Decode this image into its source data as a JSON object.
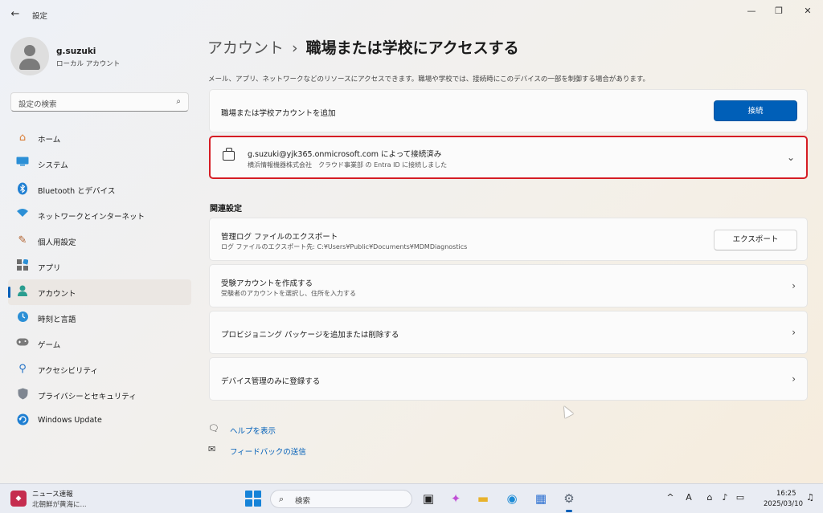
{
  "window": {
    "title": "設定",
    "back_icon": "back-arrow-icon",
    "controls": [
      "minimize",
      "restore",
      "close"
    ]
  },
  "user": {
    "name": "g.suzuki",
    "type": "ローカル アカウント"
  },
  "sidebar": {
    "search_placeholder": "設定の検索",
    "items": [
      {
        "label": "ホーム",
        "icon": "home-icon",
        "active": false
      },
      {
        "label": "システム",
        "icon": "system-icon",
        "active": false
      },
      {
        "label": "Bluetooth とデバイス",
        "icon": "bluetooth-icon",
        "active": false
      },
      {
        "label": "ネットワークとインターネット",
        "icon": "network-icon",
        "active": false
      },
      {
        "label": "個人用設定",
        "icon": "personalization-icon",
        "active": false
      },
      {
        "label": "アプリ",
        "icon": "apps-icon",
        "active": false
      },
      {
        "label": "アカウント",
        "icon": "accounts-icon",
        "active": true
      },
      {
        "label": "時刻と言語",
        "icon": "time-language-icon",
        "active": false
      },
      {
        "label": "ゲーム",
        "icon": "gaming-icon",
        "active": false
      },
      {
        "label": "アクセシビリティ",
        "icon": "accessibility-icon",
        "active": false
      },
      {
        "label": "プライバシーとセキュリティ",
        "icon": "privacy-shield-icon",
        "active": false
      },
      {
        "label": "Windows Update",
        "icon": "windows-update-icon",
        "active": false
      }
    ]
  },
  "main": {
    "breadcrumb_parent": "アカウント",
    "breadcrumb_separator": "›",
    "breadcrumb_current": "職場または学校にアクセスする",
    "description": "メール、アプリ、ネットワークなどのリソースにアクセスできます。職場や学校では、接続時にこのデバイスの一部を制御する場合があります。",
    "add_account": {
      "label": "職場または学校アカウントを追加",
      "button": "接続"
    },
    "connected_account": {
      "title": "g.suzuki@yjk365.onmicrosoft.com によって接続済み",
      "subtitle": "横浜情報機器株式会社　クラウド事業部 の Entra ID に接続しました",
      "icon": "briefcase-icon"
    },
    "related_heading": "関連設定",
    "related": [
      {
        "title": "管理ログ ファイルのエクスポート",
        "subtitle": "ログ ファイルのエクスポート先: C:¥Users¥Public¥Documents¥MDMDiagnostics",
        "button": "エクスポート"
      },
      {
        "title": "受験アカウントを作成する",
        "subtitle": "受験者のアカウントを選択し、住所を入力する"
      },
      {
        "title": "プロビジョニング パッケージを追加または削除する",
        "subtitle": ""
      },
      {
        "title": "デバイス管理のみに登録する",
        "subtitle": ""
      }
    ],
    "links": [
      {
        "label": "ヘルプを表示",
        "icon": "help-icon"
      },
      {
        "label": "フィードバックの送信",
        "icon": "feedback-icon"
      }
    ]
  },
  "taskbar": {
    "news_title": "ニュース速報",
    "news_headline": "北朝鮮が黄海に...",
    "search_placeholder": "検索",
    "time": "16:25",
    "date": "2025/03/10",
    "accent": "#005fb8"
  }
}
